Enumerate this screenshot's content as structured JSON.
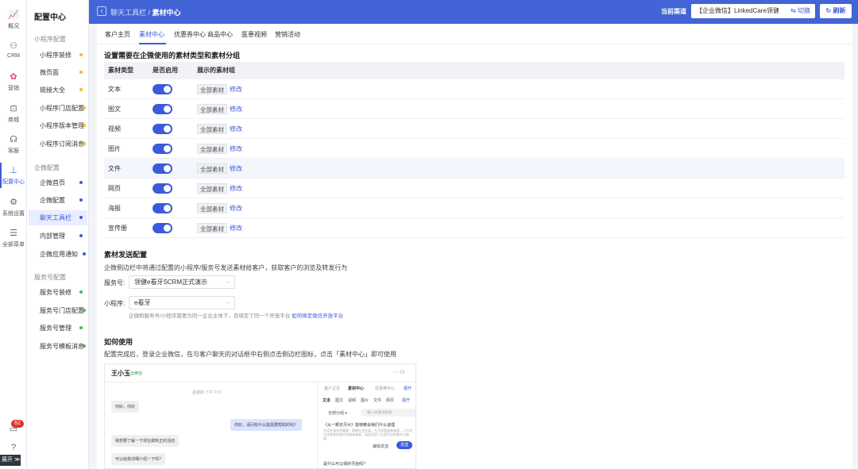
{
  "rail": {
    "items": [
      {
        "label": "概况",
        "icon": "chart-icon"
      },
      {
        "label": "CRM",
        "icon": "users-icon"
      },
      {
        "label": "营销",
        "icon": "flower-icon"
      },
      {
        "label": "商城",
        "icon": "bag-icon"
      },
      {
        "label": "客服",
        "icon": "headset-icon"
      },
      {
        "label": "配置中心",
        "icon": "org-chart-icon"
      },
      {
        "label": "系统设置",
        "icon": "gear-icon"
      },
      {
        "label": "全部菜单",
        "icon": "menu-search-icon"
      }
    ],
    "badge": "62",
    "expand_label": "展开 ≫"
  },
  "submenu": {
    "title": "配置中心",
    "groups": [
      {
        "title": "小程序配置",
        "items": [
          "小程序装修",
          "微页面",
          "链接大全",
          "小程序门店配置",
          "小程序版本管理",
          "小程序订阅消息"
        ]
      },
      {
        "title": "企微配置",
        "items": [
          "企微首页",
          "企微配置",
          "聊天工具栏",
          "内部管理",
          "企微应用通知"
        ]
      },
      {
        "title": "服务号配置",
        "items": [
          "服务号装修",
          "服务号门店配置",
          "服务号管理",
          "服务号模板消息"
        ]
      }
    ]
  },
  "topbar": {
    "crumb_parent": "聊天工具栏",
    "crumb_sep": " / ",
    "crumb_current": "素材中心",
    "channel_label": "当前渠道",
    "channel_value": "【企业微信】LinkedCare领健",
    "switch_label": "切换",
    "refresh_label": "刷新"
  },
  "tabs": [
    "客户主页",
    "素材中心",
    "优惠券中心",
    "商品中心",
    "医患视频",
    "营销活动"
  ],
  "section1": {
    "title": "设置需要在企微使用的素材类型和素材分组",
    "headers": [
      "素材类型",
      "是否启用",
      "展示的素材组"
    ],
    "rows": [
      {
        "type": "文本",
        "group": "全部素材",
        "action": "修改"
      },
      {
        "type": "图文",
        "group": "全部素材",
        "action": "修改"
      },
      {
        "type": "视频",
        "group": "全部素材",
        "action": "修改"
      },
      {
        "type": "图片",
        "group": "全部素材",
        "action": "修改"
      },
      {
        "type": "文件",
        "group": "全部素材",
        "action": "修改"
      },
      {
        "type": "网页",
        "group": "全部素材",
        "action": "修改"
      },
      {
        "type": "海报",
        "group": "全部素材",
        "action": "修改"
      },
      {
        "type": "宣传册",
        "group": "全部素材",
        "action": "修改"
      }
    ]
  },
  "section2": {
    "title": "素材发送配置",
    "desc": "企微侧边栏中将通过配置的小程序/服务号发送素材给客户，获取客户的浏览及转发行为",
    "service_label": "服务号:",
    "service_value": "领健e看牙SCRM正式演示",
    "mini_label": "小程序:",
    "mini_value": "e看牙",
    "hint": "企微和服务号/小程序需要为同一企业主体下，且绑定了同一个开放平台",
    "hint_link": "如何绑定微信开放平台"
  },
  "section3": {
    "title": "如何使用",
    "desc": "配置完成后，登录企业微信，在与客户聊天的对话框中右侧点击侧边栏图标，点击「素材中心」即可使用"
  },
  "preview": {
    "name": "王小玉",
    "wx_tag": "@微信",
    "icons": "···  ⚇",
    "time": "星期四 下午 2:57",
    "msg1": "你好，你好",
    "msg2": "你好，请问有什么能需要帮助的吗？",
    "msg3": "我想要了解一下现在做矫正的活动",
    "msg4": "可以给我详细介绍一下吗?",
    "tabs": [
      "客户主页",
      "素材中心",
      "优惠券中心",
      "展开"
    ],
    "subtabs": [
      "文本",
      "图文",
      "视频",
      "图片",
      "文件",
      "网页",
      "展开"
    ],
    "filter": "全部分组 ▾",
    "search_placeholder": "输入关键词搜索",
    "article": "《从一颗无牙大》能够教会我们什么道理",
    "article_desc": "牙齿外观非常重要，随着社会发展，生活质量越来越高，人们对牙齿美观的要求也越来越高，因此很多人在意牙齿的整齐与美观...",
    "edit": "编辑发送",
    "send": "发送",
    "bottom": "是什么可以保护牙齿吗?"
  },
  "colors": {
    "accent": "#3b5bdb",
    "topbar": "#4264d6",
    "dot_yellow": "#f5b82e",
    "dot_blue": "#3b5bdb",
    "dot_green": "#40c057",
    "badge": "#e03131"
  }
}
